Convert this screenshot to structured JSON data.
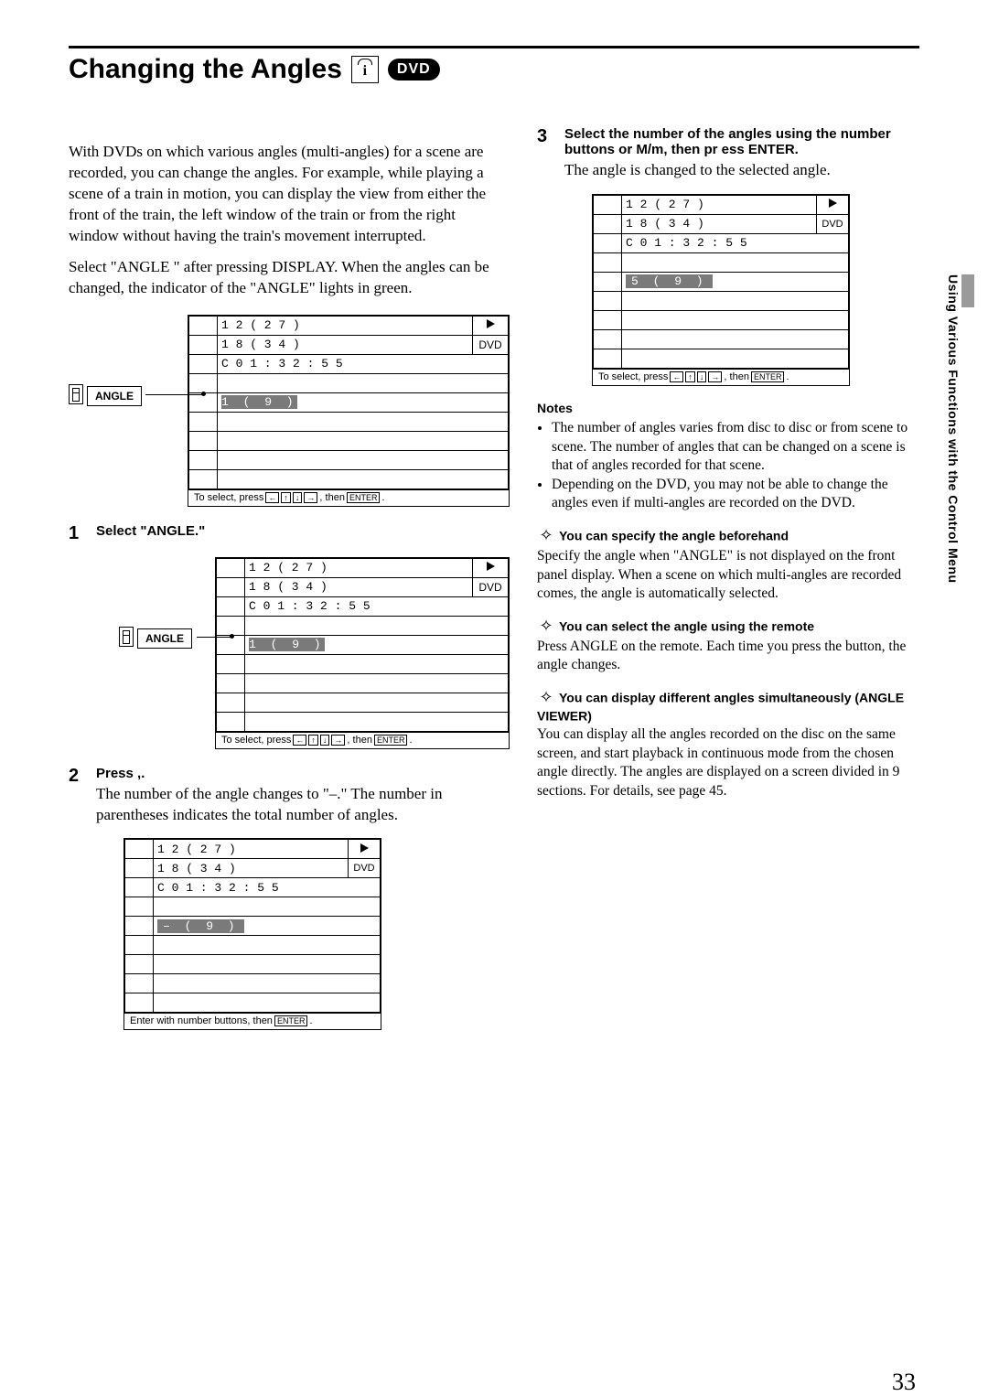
{
  "heading": "Changing the Angles",
  "dvd_badge": "DVD",
  "side_text": "Using Various Functions with the Control Menu",
  "page_number": "33",
  "intro_p1": "With DVDs on which various angles (multi-angles) for a scene are recorded, you can change the angles.  For example, while playing a scene of a train in motion, you can display the view from either the front of the train, the left window of the train or from the right window without having the train's movement interrupted.",
  "intro_p2": "Select \"ANGLE \" after pressing DISPLAY.  When the angles can be changed, the indicator of the \"ANGLE\" lights in green.",
  "angle_label": "ANGLE",
  "osd": {
    "title_line": "1 2 ( 2 7 )",
    "chapter_line": "1 8 ( 3 4 )",
    "time_line": "C  0 1 : 3 2 : 5 5",
    "dvd": "DVD",
    "angle_1_9": "1 ( 9 )",
    "dash_9": "– ( 9 )",
    "angle_5_9": "5 ( 9 )",
    "foot_select": "To select, press",
    "foot_then": ", then",
    "foot_enter": "ENTER",
    "foot_period": ".",
    "foot_enterwith": "Enter with number buttons, then"
  },
  "steps": {
    "s1_head": "Select \"ANGLE.\"",
    "s2_head": "Press ,.",
    "s2_body": "The number of the angle changes to \"–.\"  The number in parentheses indicates the total number of angles.",
    "s3_head": "Select the number of the angles using the number buttons or  M/m, then pr ess ENTER.",
    "s3_body": "The angle is changed to the selected angle."
  },
  "notes": {
    "head": "Notes",
    "n1": "The number of angles varies from disc to disc or from scene to scene.  The number of angles that can be changed on a scene is that of angles recorded for that scene.",
    "n2": "Depending on the DVD, you may not be able to change the angles even if multi-angles are recorded on the DVD."
  },
  "tip1": {
    "title": "You can specify the angle beforehand",
    "body": "Specify the angle when \"ANGLE\" is not displayed on the front panel display.  When a scene on which multi-angles are recorded comes, the angle is automatically selected."
  },
  "tip2": {
    "title": "You can select the angle using the remote",
    "body": "Press ANGLE on the remote.  Each time you press the button, the angle changes."
  },
  "tip3": {
    "title": "You can display different angles simultaneously (ANGLE VIEWER)",
    "body": "You can display all the angles recorded on the disc on the same screen, and start playback in continuous mode from the chosen angle directly.  The angles are displayed on a screen divided in 9 sections.  For details, see page 45."
  }
}
